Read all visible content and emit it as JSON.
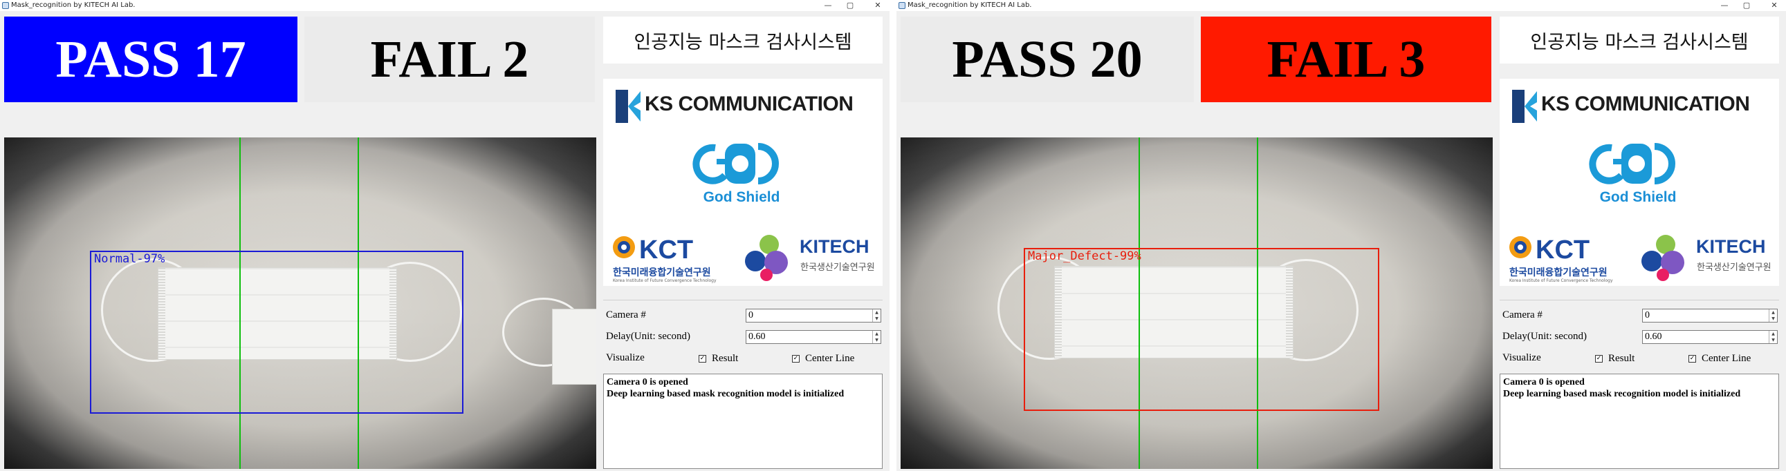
{
  "colors": {
    "pass_active": "#0000ff",
    "fail_active": "#ff1a00",
    "inactive": "#ebebeb",
    "normal_box": "#1a1ad6",
    "defect_box": "#e81e0c",
    "center_line": "#0dbf0d"
  },
  "windows": [
    {
      "title": "Mask_recognition by KITECH AI Lab.",
      "window_controls": {
        "minimize": "—",
        "maximize": "▢",
        "close": "✕"
      },
      "pass": {
        "label": "PASS 17",
        "active": true,
        "text_color": "#ffffff"
      },
      "fail": {
        "label": "FAIL 2",
        "active": false,
        "text_color": "#000000"
      },
      "detection": {
        "label": "Normal-97%",
        "type": "normal"
      },
      "panel": {
        "system_title": "인공지능 마스크 검사시스템",
        "logos": {
          "ks": {
            "icon": "ks-logo-icon",
            "text": "KS COMMUNICATION"
          },
          "godshield": {
            "icon": "god-shield-logo-icon",
            "text": "God Shield"
          },
          "kct": {
            "icon": "kct-logo-icon",
            "sub": "한국미래융합기술연구원",
            "tiny": "Korea Institute of Future Convergence Technology"
          },
          "kitech": {
            "icon": "kitech-logo-icon",
            "text": "KITECH",
            "sub": "한국생산기술연구원"
          }
        },
        "camera_label": "Camera #",
        "camera_value": "0",
        "delay_label": "Delay(Unit: second)",
        "delay_value": "0.60",
        "visualize_label": "Visualize",
        "result_label": "Result",
        "result_checked": "✓",
        "center_line_label": "Center Line",
        "center_line_checked": "✓",
        "spin_up": "▲",
        "spin_down": "▼",
        "log": [
          "Camera 0 is opened",
          "Deep learning based mask recognition model is initialized"
        ]
      }
    },
    {
      "title": "Mask_recognition by KITECH AI Lab.",
      "window_controls": {
        "minimize": "—",
        "maximize": "▢",
        "close": "✕"
      },
      "pass": {
        "label": "PASS 20",
        "active": false,
        "text_color": "#000000"
      },
      "fail": {
        "label": "FAIL 3",
        "active": true,
        "text_color": "#000000"
      },
      "detection": {
        "label": "Major_Defect-99%",
        "type": "defect"
      },
      "panel": {
        "system_title": "인공지능 마스크 검사시스템",
        "logos": {
          "ks": {
            "icon": "ks-logo-icon",
            "text": "KS COMMUNICATION"
          },
          "godshield": {
            "icon": "god-shield-logo-icon",
            "text": "God Shield"
          },
          "kct": {
            "icon": "kct-logo-icon",
            "sub": "한국미래융합기술연구원",
            "tiny": "Korea Institute of Future Convergence Technology"
          },
          "kitech": {
            "icon": "kitech-logo-icon",
            "text": "KITECH",
            "sub": "한국생산기술연구원"
          }
        },
        "camera_label": "Camera #",
        "camera_value": "0",
        "delay_label": "Delay(Unit: second)",
        "delay_value": "0.60",
        "visualize_label": "Visualize",
        "result_label": "Result",
        "result_checked": "✓",
        "center_line_label": "Center Line",
        "center_line_checked": "✓",
        "spin_up": "▲",
        "spin_down": "▼",
        "log": [
          "Camera 0 is opened",
          "Deep learning based mask recognition model is initialized"
        ]
      }
    }
  ]
}
